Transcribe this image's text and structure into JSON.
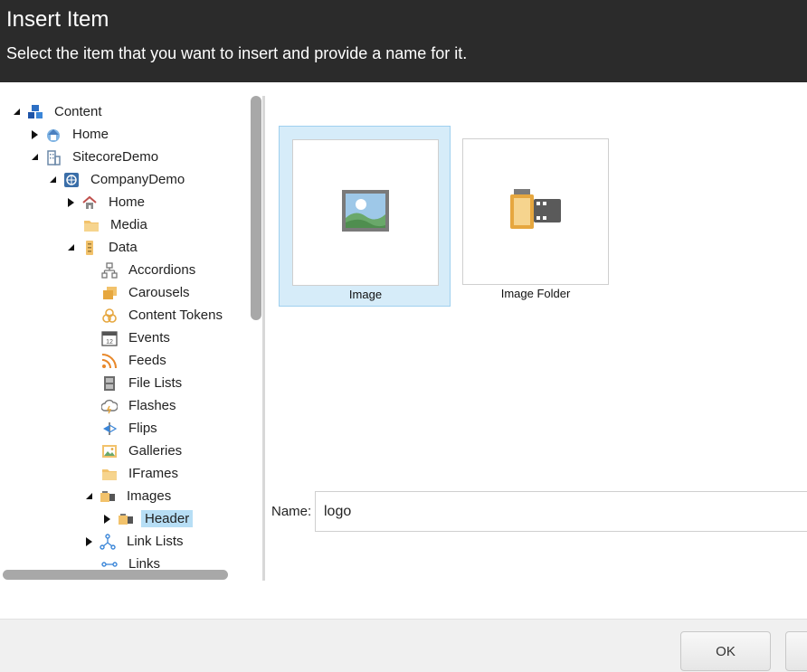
{
  "dialog": {
    "title": "Insert Item",
    "subtitle": "Select the item that you want to insert and provide a name for it."
  },
  "tree": {
    "items": [
      {
        "label": "Content",
        "icon": "content-icon",
        "expanded": true
      },
      {
        "label": "Home",
        "icon": "home-icon",
        "expanded": false
      },
      {
        "label": "SitecoreDemo",
        "icon": "building-icon",
        "expanded": true
      },
      {
        "label": "CompanyDemo",
        "icon": "globe-icon",
        "expanded": true
      },
      {
        "label": "Home",
        "icon": "house-icon",
        "expanded": false
      },
      {
        "label": "Media",
        "icon": "folder-icon"
      },
      {
        "label": "Data",
        "icon": "data-icon",
        "expanded": true
      },
      {
        "label": "Accordions",
        "icon": "hierarchy-icon"
      },
      {
        "label": "Carousels",
        "icon": "carousel-icon"
      },
      {
        "label": "Content Tokens",
        "icon": "tokens-icon"
      },
      {
        "label": "Events",
        "icon": "calendar-icon"
      },
      {
        "label": "Feeds",
        "icon": "rss-icon"
      },
      {
        "label": "File Lists",
        "icon": "file-cabinet-icon"
      },
      {
        "label": "Flashes",
        "icon": "cloud-icon"
      },
      {
        "label": "Flips",
        "icon": "flip-icon"
      },
      {
        "label": "Galleries",
        "icon": "gallery-icon"
      },
      {
        "label": "IFrames",
        "icon": "folder-icon"
      },
      {
        "label": "Images",
        "icon": "film-icon",
        "expanded": true
      },
      {
        "label": "Header",
        "icon": "film-icon",
        "expanded": false,
        "selected": true
      },
      {
        "label": "Link Lists",
        "icon": "network-icon",
        "expanded": false
      },
      {
        "label": "Links",
        "icon": "link-icon"
      }
    ]
  },
  "templates": [
    {
      "label": "Image",
      "icon": "image-icon",
      "selected": true
    },
    {
      "label": "Image Folder",
      "icon": "film-roll-icon",
      "selected": false
    }
  ],
  "name_field": {
    "label": "Name:",
    "value": "logo"
  },
  "buttons": {
    "ok": "OK"
  },
  "colors": {
    "header_bg": "#2b2b2b",
    "selection_bg": "#d6ecf9",
    "tree_selection_bg": "#b7def5"
  }
}
